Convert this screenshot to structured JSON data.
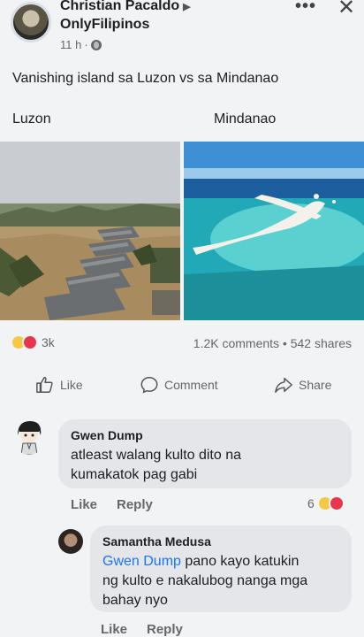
{
  "post": {
    "author": "Christian Pacaldo",
    "group": "OnlyFilipinos",
    "time": "11 h",
    "text": "Vanishing island sa Luzon vs sa Mindanao",
    "label_left": "Luzon",
    "label_right": "Mindanao",
    "reaction_count": "3k",
    "stats": "1.2K comments • 542 shares"
  },
  "actions": {
    "like": "Like",
    "comment": "Comment",
    "share": "Share"
  },
  "comments": [
    {
      "name": "Gwen Dump",
      "line1": "atleast walang kulto dito na",
      "line2": "kumakatok pag gabi",
      "like": "Like",
      "reply": "Reply",
      "reactions": "6"
    },
    {
      "name": "Samantha Medusa",
      "mention": "Gwen Dump",
      "line1_rest": " pano kayo katukin",
      "line2": "ng kulto e nakalubog nanga mga",
      "line3": "bahay nyo",
      "like": "Like",
      "reply": "Reply"
    }
  ],
  "colors": {
    "link": "#1877f2",
    "bubble": "#e4e6ea",
    "background": "#f2f3f5"
  }
}
